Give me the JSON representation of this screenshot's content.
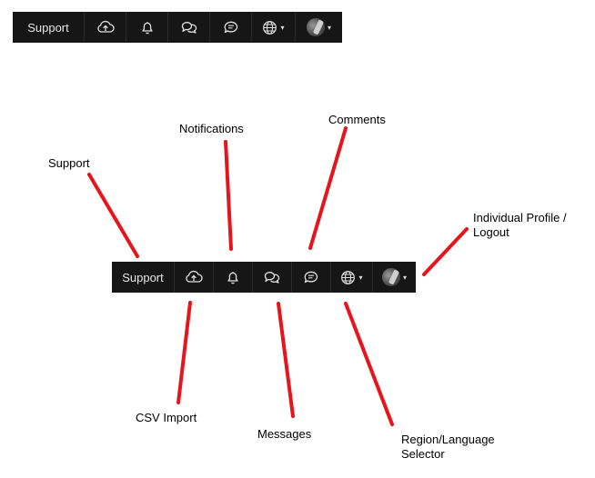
{
  "toolbar": {
    "support_label": "Support",
    "items": [
      {
        "icon": "cloud-upload-icon"
      },
      {
        "icon": "bell-icon"
      },
      {
        "icon": "chat-bubbles-icon"
      },
      {
        "icon": "comment-icon"
      },
      {
        "icon": "globe-icon"
      },
      {
        "icon": "avatar"
      }
    ]
  },
  "callouts": {
    "support": "Support",
    "notifications": "Notifications",
    "comments": "Comments",
    "profile_line1": "Individual Profile /",
    "profile_line2": "Logout",
    "csv_import": "CSV Import",
    "messages": "Messages",
    "region_line1": "Region/Language",
    "region_line2": "Selector"
  },
  "colors": {
    "toolbar_bg": "#161616",
    "leader_line": "#e8141c"
  }
}
